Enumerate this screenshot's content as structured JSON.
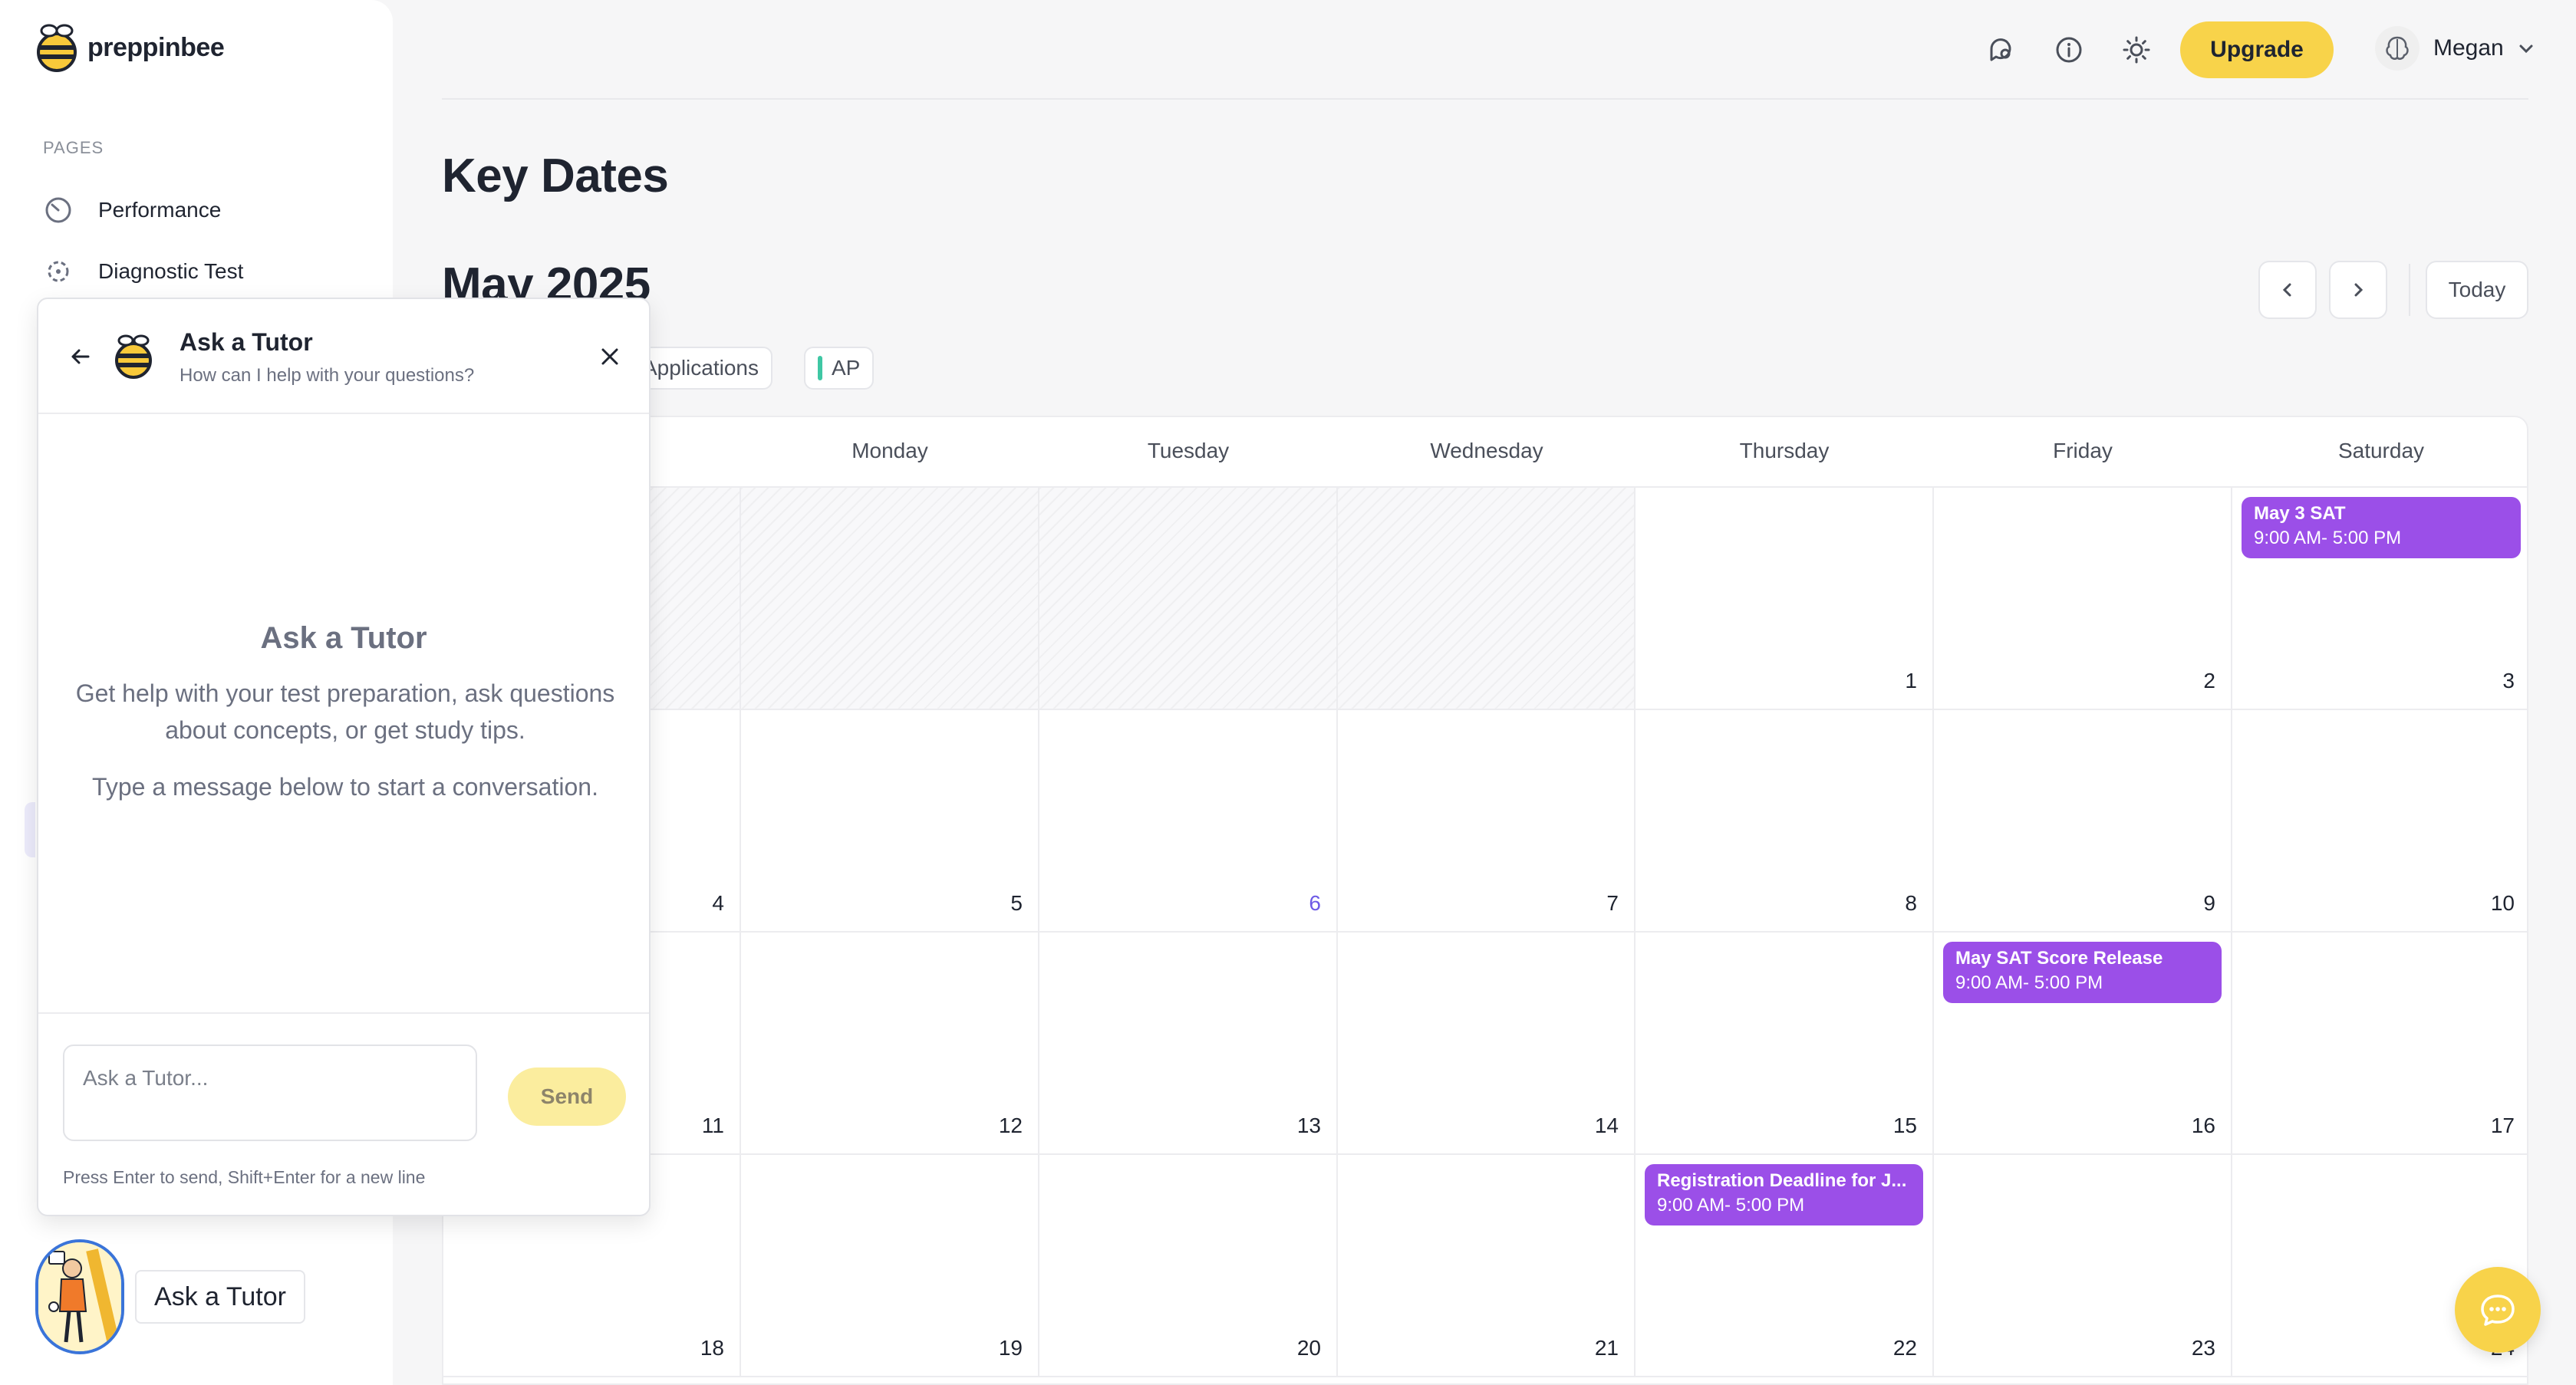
{
  "app": {
    "brand_name": "preppinbee",
    "accent_color": "#f8d34a",
    "event_color": "#9b4fe8"
  },
  "sidebar": {
    "section_label": "PAGES",
    "items": [
      {
        "label": "Performance",
        "icon": "gauge-icon"
      },
      {
        "label": "Diagnostic Test",
        "icon": "target-icon"
      }
    ]
  },
  "header": {
    "icons": [
      "search-chat-icon",
      "info-icon",
      "sun-icon"
    ],
    "upgrade_label": "Upgrade",
    "user_name": "Megan"
  },
  "page": {
    "title": "Key Dates",
    "month_label": "May 2025",
    "today_label": "Today",
    "filters": [
      "Applications",
      "AP"
    ]
  },
  "calendar": {
    "days": [
      "Monday",
      "Tuesday",
      "Wednesday",
      "Thursday",
      "Friday",
      "Saturday"
    ],
    "weeks": [
      [
        "",
        "",
        "",
        "",
        "1",
        "2",
        "3"
      ],
      [
        "4",
        "5",
        "6",
        "7",
        "8",
        "9",
        "10"
      ],
      [
        "11",
        "12",
        "13",
        "14",
        "15",
        "16",
        "17"
      ],
      [
        "18",
        "19",
        "20",
        "21",
        "22",
        "23",
        "24"
      ]
    ],
    "events": {
      "sat_may3": {
        "title": "May 3 SAT",
        "time": "9:00 AM- 5:00 PM"
      },
      "fri_may16": {
        "title": "May SAT Score Release",
        "time": "9:00 AM- 5:00 PM"
      },
      "thu_may22": {
        "title": "Registration Deadline for J...",
        "time": "9:00 AM- 5:00 PM"
      }
    }
  },
  "chat": {
    "title": "Ask a Tutor",
    "subtitle": "How can I help with your questions?",
    "empty_title": "Ask a Tutor",
    "empty_text": "Get help with your test preparation, ask questions about concepts, or get study tips.",
    "empty_text2": "Type a message below to start a conversation.",
    "input_placeholder": "Ask a Tutor...",
    "send_label": "Send",
    "hint": "Press Enter to send, Shift+Enter for a new line"
  },
  "tutor_widget": {
    "label": "Ask a Tutor"
  }
}
